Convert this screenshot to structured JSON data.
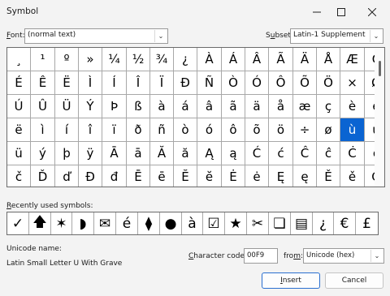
{
  "window": {
    "title": "Symbol"
  },
  "font": {
    "label": "Font:",
    "accel": "F",
    "rest": "ont:",
    "value": "(normal text)"
  },
  "subset": {
    "label": "Subset:",
    "accel": "u",
    "pre": "S",
    "rest": "bset:",
    "value": "Latin-1 Supplement"
  },
  "symbols": [
    [
      "¸",
      "¹",
      "º",
      "»",
      "¼",
      "½",
      "¾",
      "¿",
      "À",
      "Á",
      "Â",
      "Ã",
      "Ä",
      "Å",
      "Æ",
      "Ç",
      "È"
    ],
    [
      "É",
      "Ê",
      "Ë",
      "Ì",
      "Í",
      "Î",
      "Ï",
      "Ð",
      "Ñ",
      "Ò",
      "Ó",
      "Ô",
      "Õ",
      "Ö",
      "×",
      "Ø",
      "Ù"
    ],
    [
      "Ú",
      "Û",
      "Ü",
      "Ý",
      "Þ",
      "ß",
      "à",
      "á",
      "â",
      "ã",
      "ä",
      "å",
      "æ",
      "ç",
      "è",
      "é",
      "ê"
    ],
    [
      "ë",
      "ì",
      "í",
      "î",
      "ï",
      "ð",
      "ñ",
      "ò",
      "ó",
      "ô",
      "õ",
      "ö",
      "÷",
      "ø",
      "ù",
      "ú",
      "û"
    ],
    [
      "ü",
      "ý",
      "þ",
      "ÿ",
      "Ā",
      "ā",
      "Ă",
      "ă",
      "Ą",
      "ą",
      "Ć",
      "ć",
      "Ĉ",
      "ĉ",
      "Ċ",
      "ċ",
      "Č"
    ],
    [
      "č",
      "Ď",
      "ď",
      "Đ",
      "đ",
      "Ē",
      "ē",
      "Ĕ",
      "ĕ",
      "Ė",
      "ė",
      "Ę",
      "ę",
      "Ě",
      "ě",
      "Ĝ",
      "ĝ"
    ]
  ],
  "selected": {
    "row": 3,
    "col": 14
  },
  "recent": {
    "label": "Recently used symbols:",
    "accel": "R",
    "rest": "ecently used symbols:",
    "items": [
      "✓",
      "🡅",
      "✶",
      "◗",
      "✉",
      "é",
      "⧫",
      "●",
      "à",
      "☑",
      "★",
      "✂",
      "❏",
      "▤",
      "¿",
      "€",
      "£"
    ]
  },
  "unicode": {
    "label": "Unicode name:",
    "value": "Latin Small Letter U With Grave"
  },
  "char_code": {
    "label": "Character code:",
    "accel": "C",
    "rest": "haracter code:",
    "value": "00F9"
  },
  "from": {
    "label": "from:",
    "accel": "m",
    "pre": "fro",
    "rest": ":",
    "value": "Unicode (hex)"
  },
  "buttons": {
    "insert": "Insert",
    "insert_accel": "I",
    "insert_rest": "nsert",
    "cancel": "Cancel"
  },
  "icons": {
    "minimize": "minimize-icon",
    "maximize": "maximize-icon",
    "close": "close-icon",
    "dropdown": "chevron-down-icon"
  }
}
